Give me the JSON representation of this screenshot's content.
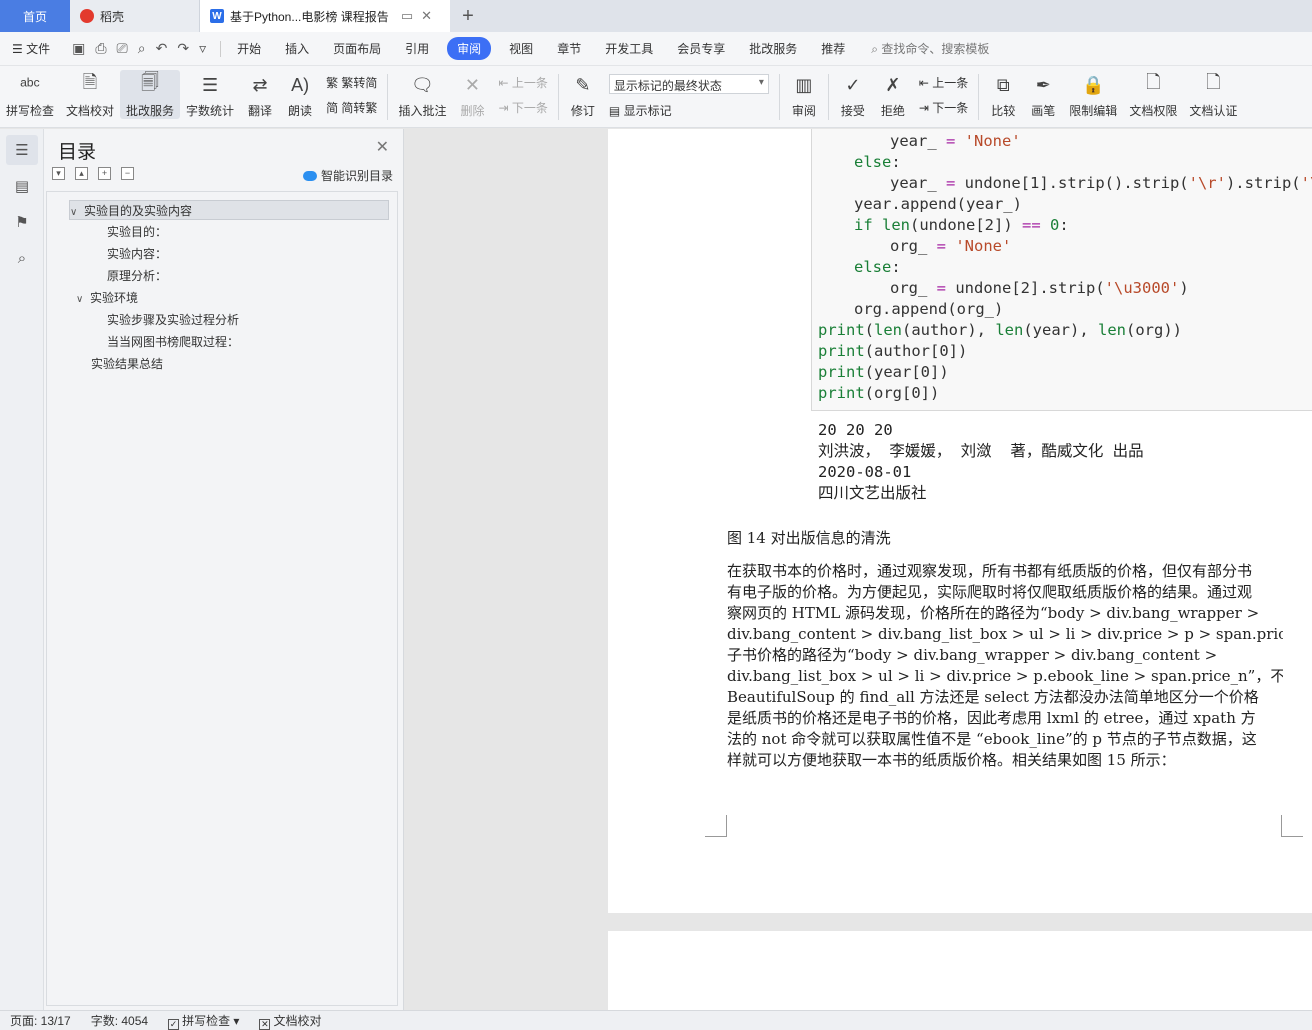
{
  "tabs": {
    "home": "首页",
    "daoke": "稻壳",
    "doc": "基于Python...电影榜 课程报告"
  },
  "menu": {
    "file": "文件",
    "items": [
      "开始",
      "插入",
      "页面布局",
      "引用",
      "审阅",
      "视图",
      "章节",
      "开发工具",
      "会员专享",
      "批改服务",
      "推荐"
    ],
    "active": "审阅",
    "search": "查找命令、搜索模板"
  },
  "ribbon": {
    "spell": "拼写检查",
    "proof": "文档校对",
    "correct": "批改服务",
    "wordcount": "字数统计",
    "translate": "翻译",
    "read": "朗读",
    "trad2simp": "繁转简",
    "simp2trad": "简转繁",
    "insert_comment": "插入批注",
    "delete": "删除",
    "prev": "上一条",
    "next": "下一条",
    "revise": "修订",
    "markup_state": "显示标记的最终状态",
    "show_markup": "显示标记",
    "review": "审阅",
    "accept": "接受",
    "reject": "拒绝",
    "prev2": "上一条",
    "next2": "下一条",
    "compare": "比较",
    "pen": "画笔",
    "restrict": "限制编辑",
    "rights": "文档权限",
    "cert": "文档认证"
  },
  "toc": {
    "title": "目录",
    "smart": "智能识别目录",
    "items": [
      {
        "label": "实验目的及实验内容"
      },
      {
        "label": "实验目的："
      },
      {
        "label": "实验内容："
      },
      {
        "label": "原理分析："
      },
      {
        "label": "实验环境"
      },
      {
        "label": "实验步骤及实验过程分析"
      },
      {
        "label": "当当网图书榜爬取过程："
      },
      {
        "label": "实验结果总结"
      }
    ]
  },
  "code": {
    "l1a": "year_ ",
    "l1b": "=",
    "l1c": " 'None'",
    "l2": "else",
    "l3a": "year_ ",
    "l3b": "=",
    "l3c": " undone[1].strip().strip(",
    "l3d": "'\\r'",
    "l3e": ").strip(",
    "l3f": "'\\n",
    "l4": "year.append(year_)",
    "l5a": "if",
    "l5b": " len",
    "l5c": "(undone[2]) ",
    "l5d": "==",
    "l5e": " 0",
    "l6a": "org_ ",
    "l6b": "=",
    "l6c": " 'None'",
    "l7": "else",
    "l8a": "org_ ",
    "l8b": "=",
    "l8c": " undone[2].strip(",
    "l8d": "'\\u3000'",
    "l8e": ")",
    "l9": "org.append(org_)",
    "l10a": "print",
    "l10b": "(",
    "l10c": "len",
    "l10d": "(author), ",
    "l10e": "len",
    "l10f": "(year), ",
    "l10g": "len",
    "l10h": "(org))",
    "l11a": "print",
    "l11b": "(author[0])",
    "l12a": "print",
    "l12b": "(year[0])",
    "l13a": "print",
    "l13b": "(org[0])"
  },
  "output": {
    "o1": "20 20 20",
    "o2": "刘洪波， 李媛媛， 刘潋  著，酷威文化 出品",
    "o3": "2020-08-01",
    "o4": "四川文艺出版社"
  },
  "doc": {
    "caption": "图 14 对出版信息的清洗",
    "para": [
      "在获取书本的价格时，通过观察发现，所有书都有纸质版的价格，但仅有部分书",
      "有电子版的价格。为方便起见，实际爬取时将仅爬取纸质版价格的结果。通过观",
      "察网页的 HTML 源码发现，价格所在的路径为“body > div.bang_wrapper >",
      "div.bang_content > div.bang_list_box > ul > li > div.price > p > span.price_n”，而电",
      "子书价格的路径为“body > div.bang_wrapper > div.bang_content >",
      "div.bang_list_box > ul > li > div.price > p.ebook_line > span.price_n”，不论是",
      "BeautifulSoup 的 find_all 方法还是 select 方法都没办法简单地区分一个价格",
      "是纸质书的价格还是电子书的价格，因此考虑用 lxml 的 etree，通过 xpath 方",
      "法的 not 命令就可以获取属性值不是 “ebook_line”的 p 节点的子节点数据，这",
      "样就可以方便地获取一本书的纸质版价格。相关结果如图 15 所示："
    ]
  },
  "status": {
    "page": "页面: 13/17",
    "words": "字数: 4054",
    "spell": "拼写检查",
    "proof": "文档校对"
  },
  "colors": {
    "accent": "#3c6ff5",
    "home_tab": "#4a7de3"
  }
}
